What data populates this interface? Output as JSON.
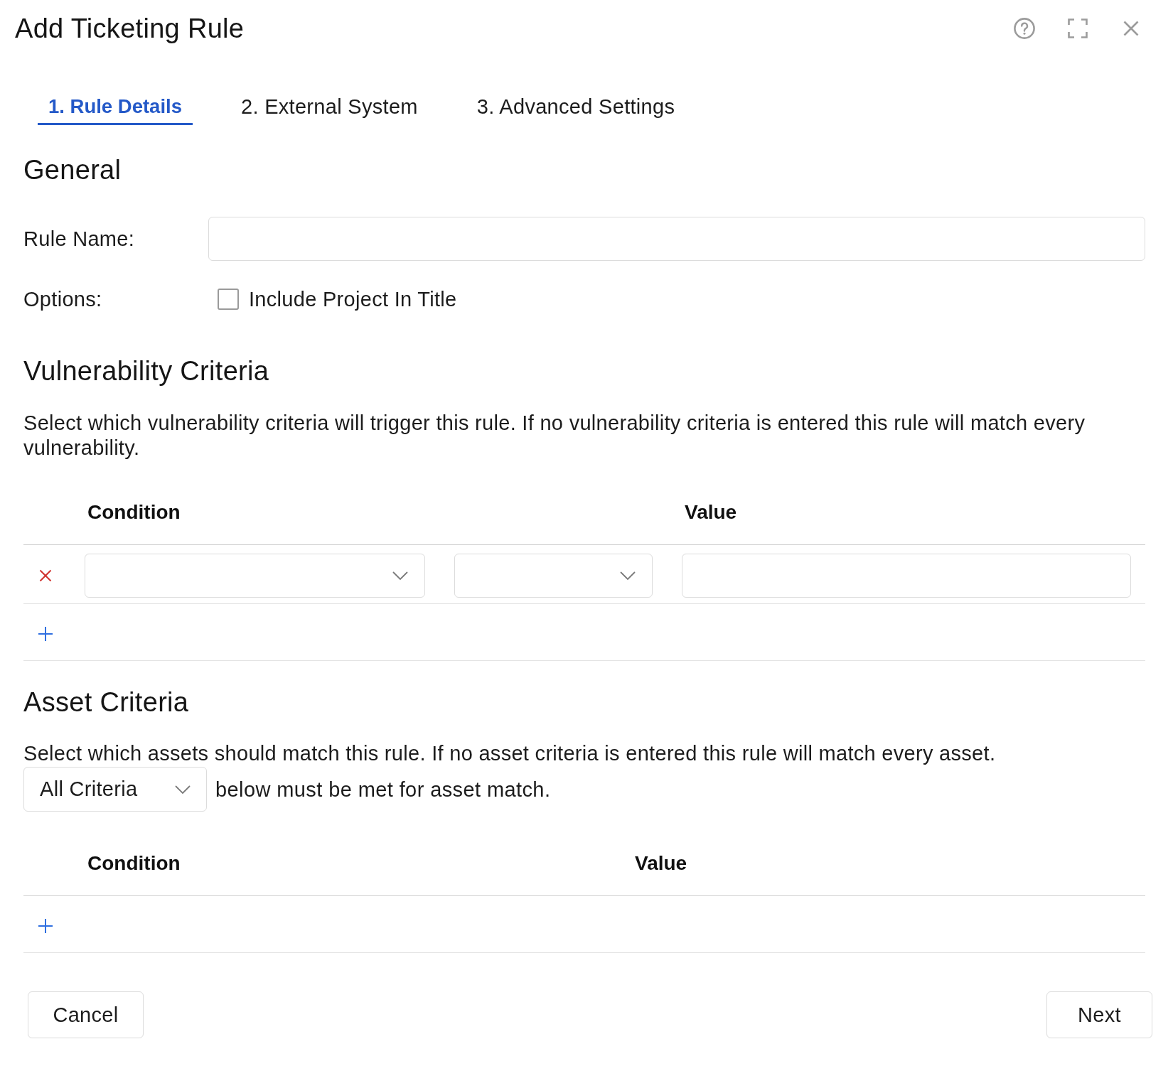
{
  "dialog": {
    "title": "Add Ticketing Rule"
  },
  "tabs": [
    {
      "label": "1. Rule Details",
      "selected": true
    },
    {
      "label": "2. External System",
      "selected": false
    },
    {
      "label": "3. Advanced Settings",
      "selected": false
    }
  ],
  "general": {
    "heading": "General",
    "rule_name": {
      "label": "Rule Name:"
    },
    "options": {
      "label": "Options:",
      "checkbox": {
        "label": "Include Project In Title",
        "checked": false
      }
    }
  },
  "vulnerability_criteria": {
    "heading": "Vulnerability Criteria",
    "description": "Select which vulnerability criteria will trigger this rule. If no vulnerability criteria is entered this rule will match every vulnerability.",
    "table": {
      "columns": [
        "Condition",
        "Value"
      ],
      "rows": [
        {
          "kind": "condition"
        }
      ]
    }
  },
  "asset_criteria": {
    "heading": "Asset Criteria",
    "description": "Select which assets should match this rule. If no asset criteria is entered this rule will match every asset.",
    "match": {
      "value": "All Criteria",
      "suffix": "below must be met for asset match."
    },
    "table": {
      "columns": [
        "Condition",
        "Value"
      ]
    }
  },
  "footer": {
    "cancel": "Cancel",
    "next": "Next"
  }
}
